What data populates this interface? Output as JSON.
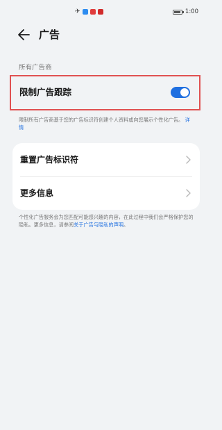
{
  "status_bar": {
    "time": "1:00",
    "app_icon_colors": [
      "#2d8cf0",
      "#e03c3c",
      "#d12b2b"
    ]
  },
  "header": {
    "title": "广告",
    "back_icon": "arrow-left-icon"
  },
  "section_label": "所有广告商",
  "limit_tracking": {
    "label": "限制广告跟踪",
    "enabled": true,
    "accent_color": "#1f6fe0",
    "highlight_color": "#e05151"
  },
  "limit_description": {
    "text": "限制所有广告商基于您的广告标识符创建个人资料或向您展示个性化广告。",
    "link": "详情"
  },
  "list": [
    {
      "label": "重置广告标识符",
      "icon": "chevron-right-icon"
    },
    {
      "label": "更多信息",
      "icon": "chevron-right-icon"
    }
  ],
  "footer": {
    "text": "个性化广告服务会为您匹配可能感兴趣的内容，在此过程中我们会严格保护您的隐私。更多信息，请参阅",
    "link": "关于广告与隐私的声明",
    "suffix": "。"
  }
}
